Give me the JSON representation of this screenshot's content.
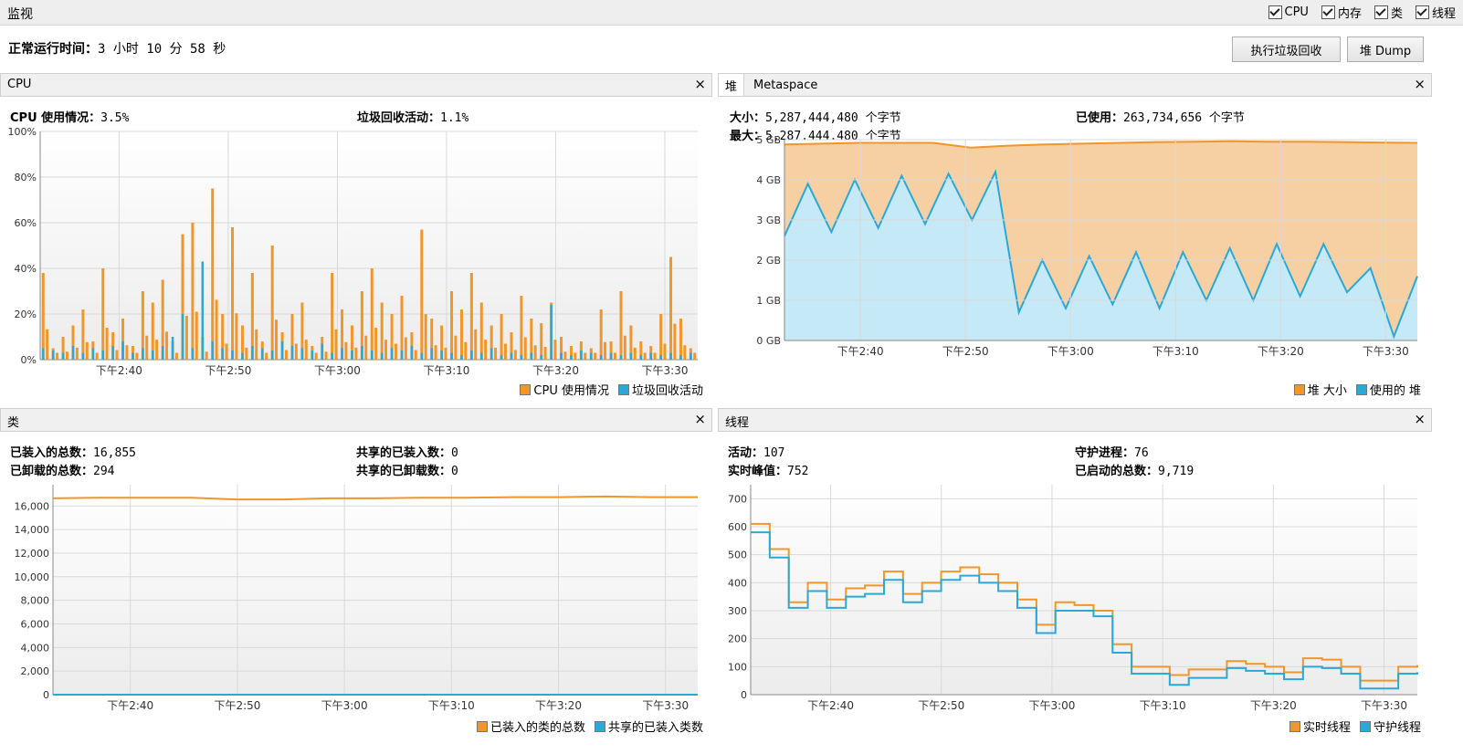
{
  "header": {
    "title": "监视",
    "checks": [
      {
        "label": "CPU",
        "checked": true
      },
      {
        "label": "内存",
        "checked": true
      },
      {
        "label": "类",
        "checked": true
      },
      {
        "label": "线程",
        "checked": true
      }
    ]
  },
  "uptime": {
    "label": "正常运行时间：",
    "value": "3 小时 10 分 58 秒"
  },
  "buttons": {
    "gc": "执行垃圾回收",
    "heap_dump": "堆 Dump"
  },
  "colors": {
    "orange": "#f0962a",
    "blue": "#2aa8d6"
  },
  "cpu_panel": {
    "title": "CPU",
    "close": "×",
    "usage_label": "CPU 使用情况：",
    "usage_value": "3.5%",
    "gc_label": "垃圾回收活动：",
    "gc_value": "1.1%",
    "legend": [
      "CPU 使用情况",
      "垃圾回收活动"
    ]
  },
  "memory_panel": {
    "tabs": [
      "堆",
      "Metaspace"
    ],
    "close": "×",
    "size_label": "大小：",
    "size_value": "5,287,444,480 个字节",
    "max_label": "最大：",
    "max_value": "5,287,444,480 个字节",
    "used_label": "已使用：",
    "used_value": "263,734,656 个字节",
    "legend": [
      "堆 大小",
      "使用的 堆"
    ]
  },
  "classes_panel": {
    "title": "类",
    "close": "×",
    "loaded_label": "已装入的总数：",
    "loaded_value": "16,855",
    "unloaded_label": "已卸载的总数：",
    "unloaded_value": "294",
    "shared_loaded_label": "共享的已装入数：",
    "shared_loaded_value": "0",
    "shared_unloaded_label": "共享的已卸载数：",
    "shared_unloaded_value": "0",
    "legend": [
      "已装入的类的总数",
      "共享的已装入类数"
    ]
  },
  "threads_panel": {
    "title": "线程",
    "close": "×",
    "live_label": "活动：",
    "live_value": "107",
    "peak_label": "实时峰值：",
    "peak_value": "752",
    "daemon_label": "守护进程：",
    "daemon_value": "76",
    "started_label": "已启动的总数：",
    "started_value": "9,719",
    "legend": [
      "实时线程",
      "守护线程"
    ]
  },
  "chart_data": [
    {
      "id": "cpu",
      "type": "area",
      "xlabels": [
        "下午2:40",
        "下午2:50",
        "下午3:00",
        "下午3:10",
        "下午3:20",
        "下午3:30"
      ],
      "yticks": [
        "0%",
        "20%",
        "40%",
        "60%",
        "80%",
        "100%"
      ],
      "ylim": [
        0,
        100
      ],
      "series": [
        {
          "name": "CPU 使用情况",
          "peaks": [
            38,
            5,
            10,
            15,
            22,
            8,
            40,
            12,
            18,
            6,
            30,
            25,
            35,
            8,
            55,
            60,
            10,
            75,
            20,
            58,
            15,
            38,
            8,
            50,
            12,
            20,
            25,
            6,
            10,
            38,
            22,
            15,
            30,
            40,
            25,
            20,
            28,
            12,
            57,
            18,
            15,
            30,
            22,
            38,
            25,
            15,
            20,
            12,
            28,
            18,
            16,
            25,
            10,
            6,
            8,
            5,
            22,
            8,
            30,
            15,
            8,
            6,
            20,
            45,
            18,
            5
          ]
        },
        {
          "name": "垃圾回收活动",
          "peaks": [
            5,
            4,
            3,
            6,
            3,
            5,
            4,
            6,
            8,
            3,
            5,
            4,
            6,
            10,
            20,
            5,
            43,
            8,
            5,
            4,
            3,
            6,
            5,
            4,
            8,
            6,
            5,
            4,
            7,
            3,
            5,
            4,
            6,
            4,
            3,
            5,
            4,
            6,
            3,
            5,
            4,
            3,
            2,
            4,
            3,
            5,
            2,
            3,
            2,
            3,
            2,
            24,
            3,
            2,
            4,
            3,
            2,
            3,
            2,
            3,
            2,
            3,
            2,
            3,
            2,
            3
          ]
        }
      ]
    },
    {
      "id": "heap",
      "type": "area",
      "xlabels": [
        "下午2:40",
        "下午2:50",
        "下午3:00",
        "下午3:10",
        "下午3:20",
        "下午3:30"
      ],
      "yticks": [
        "0 GB",
        "1 GB",
        "2 GB",
        "3 GB",
        "4 GB",
        "5 GB"
      ],
      "ylim": [
        0,
        5
      ],
      "series": [
        {
          "name": "堆 大小",
          "values": [
            4.88,
            4.9,
            4.92,
            4.92,
            4.92,
            4.8,
            4.85,
            4.88,
            4.9,
            4.92,
            4.94,
            4.95,
            4.96,
            4.95,
            4.95,
            4.94,
            4.93,
            4.92
          ]
        },
        {
          "name": "使用的 堆",
          "values": [
            2.6,
            3.9,
            2.7,
            4.0,
            2.8,
            4.1,
            2.9,
            4.15,
            3.0,
            4.2,
            0.7,
            2.0,
            0.8,
            2.1,
            0.9,
            2.2,
            0.8,
            2.2,
            1.0,
            2.3,
            1.0,
            2.4,
            1.1,
            2.4,
            1.2,
            1.8,
            0.1,
            1.6
          ]
        }
      ]
    },
    {
      "id": "classes",
      "type": "line",
      "xlabels": [
        "下午2:40",
        "下午2:50",
        "下午3:00",
        "下午3:10",
        "下午3:20",
        "下午3:30"
      ],
      "yticks": [
        "0",
        "2,000",
        "4,000",
        "6,000",
        "8,000",
        "10,000",
        "12,000",
        "14,000",
        "16,000"
      ],
      "ylim": [
        0,
        17800
      ],
      "series": [
        {
          "name": "已装入的类的总数",
          "values": [
            16650,
            16700,
            16700,
            16700,
            16550,
            16550,
            16650,
            16650,
            16700,
            16700,
            16750,
            16750,
            16800,
            16750,
            16750
          ]
        },
        {
          "name": "共享的已装入类数",
          "values": [
            0,
            0,
            0,
            0,
            0,
            0,
            0,
            0,
            0,
            0,
            0,
            0,
            0,
            0,
            0
          ]
        }
      ]
    },
    {
      "id": "threads",
      "type": "line",
      "xlabels": [
        "下午2:40",
        "下午2:50",
        "下午3:00",
        "下午3:10",
        "下午3:20",
        "下午3:30"
      ],
      "yticks": [
        "0",
        "100",
        "200",
        "300",
        "400",
        "500",
        "600",
        "700"
      ],
      "ylim": [
        0,
        750
      ],
      "series": [
        {
          "name": "实时线程",
          "values": [
            610,
            520,
            330,
            400,
            340,
            380,
            390,
            440,
            360,
            400,
            440,
            455,
            430,
            400,
            340,
            250,
            330,
            320,
            300,
            180,
            100,
            100,
            70,
            90,
            90,
            120,
            110,
            100,
            80,
            130,
            125,
            100,
            50,
            50,
            100,
            105
          ]
        },
        {
          "name": "守护线程",
          "values": [
            580,
            490,
            310,
            370,
            310,
            350,
            360,
            410,
            330,
            370,
            410,
            425,
            400,
            370,
            310,
            220,
            300,
            300,
            280,
            150,
            75,
            75,
            35,
            60,
            60,
            95,
            85,
            75,
            55,
            100,
            95,
            75,
            22,
            22,
            75,
            80
          ]
        }
      ]
    }
  ]
}
